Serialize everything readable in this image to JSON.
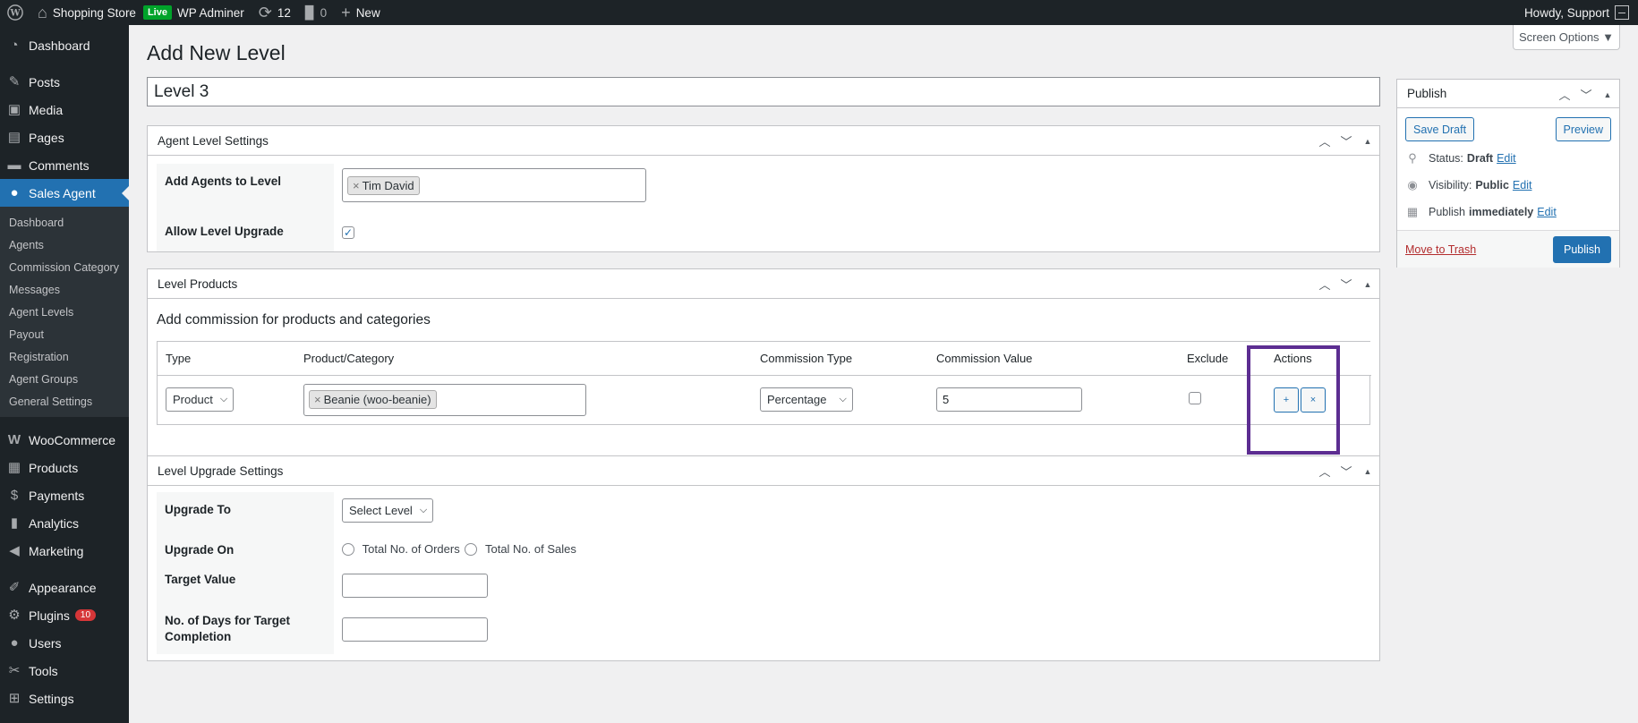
{
  "adminbar": {
    "site_name": "Shopping Store",
    "live_label": "Live",
    "wp_adminer": "WP Adminer",
    "updates_count": "12",
    "comments_count": "0",
    "new_label": "New",
    "greeting": "Howdy, Support"
  },
  "sidebar": {
    "dashboard": "Dashboard",
    "posts": "Posts",
    "media": "Media",
    "pages": "Pages",
    "comments": "Comments",
    "sales_agent": "Sales Agent",
    "submenu": [
      "Dashboard",
      "Agents",
      "Commission Category",
      "Messages",
      "Agent Levels",
      "Payout",
      "Registration",
      "Agent Groups",
      "General Settings"
    ],
    "woocommerce": "WooCommerce",
    "products": "Products",
    "payments": "Payments",
    "analytics": "Analytics",
    "marketing": "Marketing",
    "appearance": "Appearance",
    "plugins": "Plugins",
    "plugins_badge": "10",
    "users": "Users",
    "tools": "Tools",
    "settings": "Settings"
  },
  "main": {
    "page_title": "Add New Level",
    "screen_options": "Screen Options ▼",
    "title_value": "Level 3"
  },
  "agent_level_settings": {
    "heading": "Agent Level Settings",
    "add_agents_label": "Add Agents to Level",
    "agent_chip": "Tim David",
    "allow_upgrade_label": "Allow Level Upgrade",
    "allow_upgrade_checked": true
  },
  "level_products": {
    "heading": "Level Products",
    "subheading": "Add commission for products and categories",
    "columns": [
      "Type",
      "Product/Category",
      "Commission Type",
      "Commission Value",
      "Exclude",
      "Actions"
    ],
    "row": {
      "type": "Product",
      "product_chip": "Beanie (woo-beanie)",
      "commission_type": "Percentage",
      "commission_value": "5",
      "exclude_checked": false,
      "add_label": "+",
      "remove_label": "×"
    }
  },
  "level_upgrade_settings": {
    "heading": "Level Upgrade Settings",
    "upgrade_to_label": "Upgrade To",
    "upgrade_to_value": "Select Level",
    "upgrade_on_label": "Upgrade On",
    "upgrade_on_options": [
      "Total No. of Orders",
      "Total No. of Sales"
    ],
    "target_value_label": "Target Value",
    "target_value": "",
    "days_label_line1": "No. of Days for Target",
    "days_label_line2": "Completion",
    "days_value": ""
  },
  "publish": {
    "heading": "Publish",
    "save_draft": "Save Draft",
    "preview": "Preview",
    "status_label": "Status:",
    "status_value": "Draft",
    "visibility_label": "Visibility:",
    "visibility_value": "Public",
    "publish_label": "Publish",
    "publish_when": "immediately",
    "edit": "Edit",
    "move_to_trash": "Move to Trash",
    "publish_button": "Publish"
  }
}
